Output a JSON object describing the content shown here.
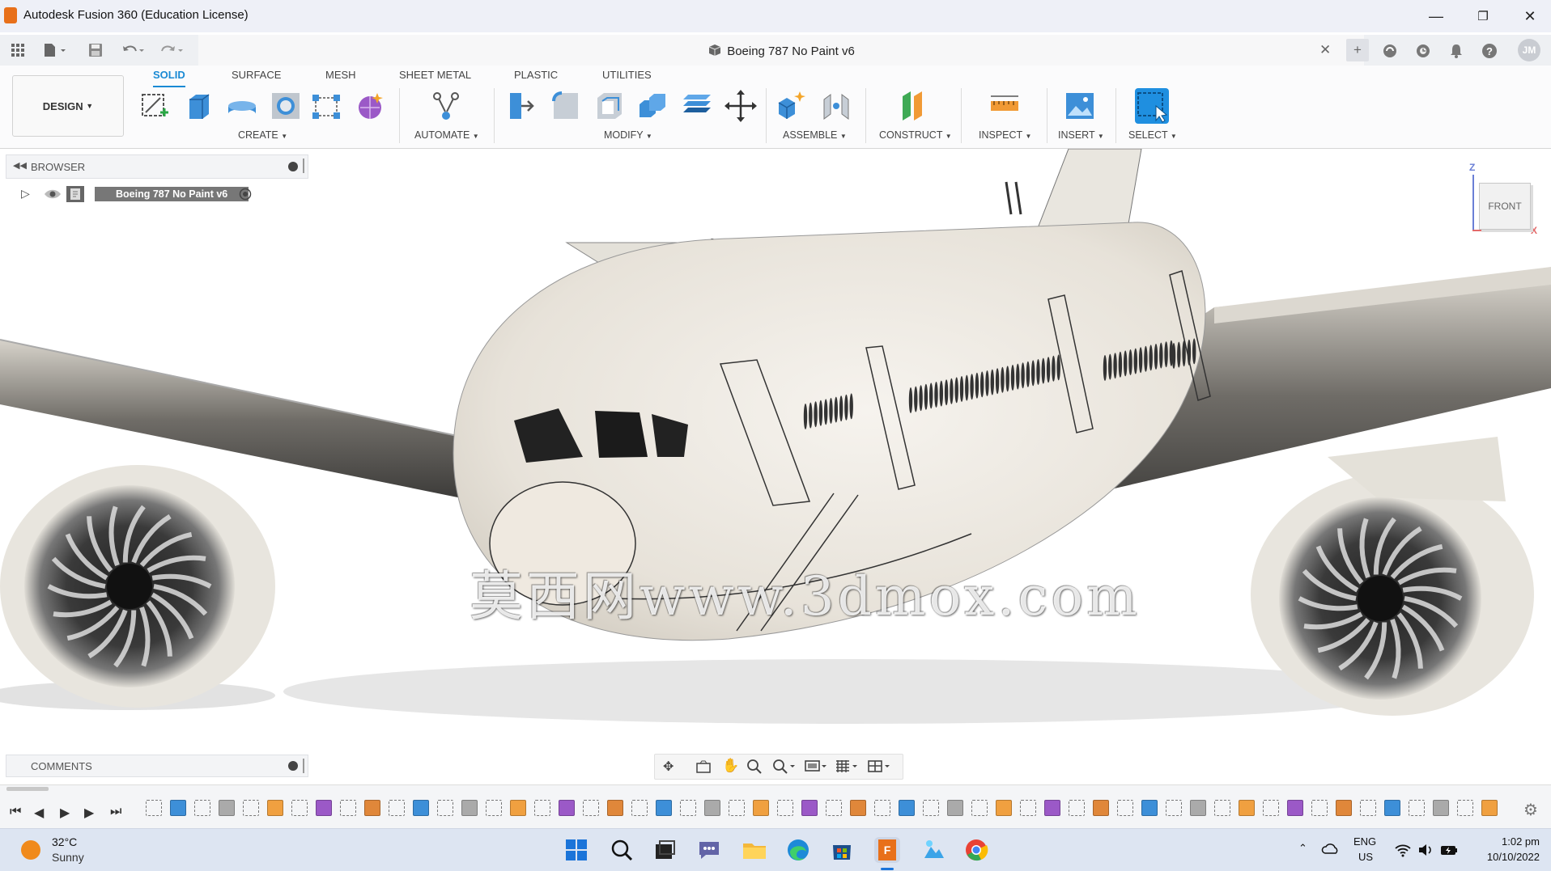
{
  "window": {
    "title": "Autodesk Fusion 360 (Education License)",
    "minimize_icon": "minimize-icon",
    "maximize_icon": "restore-icon",
    "close_icon": "close-icon"
  },
  "document": {
    "title": "Boeing 787 No Paint v6",
    "user_initials": "JM"
  },
  "ribbon": {
    "workspace": "DESIGN",
    "tabs": [
      "SOLID",
      "SURFACE",
      "MESH",
      "SHEET METAL",
      "PLASTIC",
      "UTILITIES"
    ],
    "active_tab": "SOLID",
    "groups": [
      "CREATE",
      "AUTOMATE",
      "MODIFY",
      "ASSEMBLE",
      "CONSTRUCT",
      "INSPECT",
      "INSERT",
      "SELECT"
    ]
  },
  "browser": {
    "title": "BROWSER",
    "root_item": "Boeing 787 No Paint v6"
  },
  "comments": {
    "title": "COMMENTS"
  },
  "viewcube": {
    "face": "FRONT",
    "axis_z": "Z",
    "axis_x": "X"
  },
  "watermark": "莫西网www.3dmox.com",
  "taskbar": {
    "weather_temp": "32°C",
    "weather_desc": "Sunny",
    "lang_line1": "ENG",
    "lang_line2": "US",
    "time": "1:02 pm",
    "date": "10/10/2022"
  },
  "colors": {
    "accent": "#1a8ad4",
    "fusion_orange": "#e8701a",
    "model_body": "#ece8e1"
  }
}
